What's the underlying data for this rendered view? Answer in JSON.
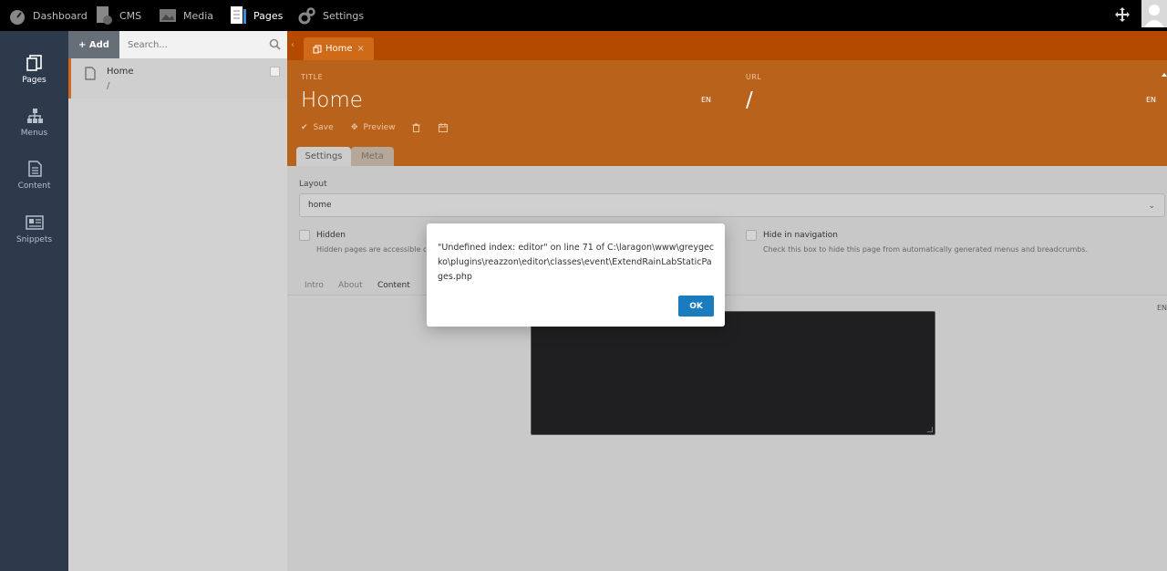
{
  "topbar": {
    "items": [
      {
        "label": "Dashboard",
        "icon": "dashboard-icon"
      },
      {
        "label": "CMS",
        "icon": "cms-icon"
      },
      {
        "label": "Media",
        "icon": "media-icon"
      },
      {
        "label": "Pages",
        "icon": "pages-icon"
      },
      {
        "label": "Settings",
        "icon": "settings-icon"
      }
    ],
    "active": "Pages"
  },
  "sidebar": {
    "items": [
      {
        "label": "Pages",
        "icon": "pages-icon"
      },
      {
        "label": "Menus",
        "icon": "menus-icon"
      },
      {
        "label": "Content",
        "icon": "content-icon"
      },
      {
        "label": "Snippets",
        "icon": "snippets-icon"
      }
    ]
  },
  "list": {
    "add_label": "+ Add",
    "search_placeholder": "Search...",
    "rows": [
      {
        "title": "Home",
        "url": "/"
      }
    ]
  },
  "editor": {
    "tab_label": "Home",
    "tab_close": "×",
    "title_label": "TITLE",
    "title_value": "Home",
    "title_lang": "EN",
    "url_label": "URL",
    "url_value": "/",
    "url_lang": "EN",
    "save_label": "Save",
    "preview_label": "Preview",
    "form_tabs": [
      "Settings",
      "Meta"
    ],
    "layout_label": "Layout",
    "layout_value": "home",
    "hidden_label": "Hidden",
    "hidden_desc": "Hidden pages are accessible only by logged-in back-end users.",
    "hide_nav_label": "Hide in navigation",
    "hide_nav_desc": "Check this box to hide this page from automatically generated menus and breadcrumbs.",
    "content_tabs": [
      "Intro",
      "About",
      "Content"
    ],
    "content_lang": "EN"
  },
  "modal": {
    "message": "\"Undefined index: editor\" on line 71 of C:\\laragon\\www\\greygecko\\plugins\\reazzon\\editor\\classes\\event\\ExtendRainLabStaticPages.php",
    "ok_label": "OK"
  },
  "colors": {
    "accent": "#d2691e",
    "header": "#b8621c",
    "ok_button": "#1a7bbf"
  }
}
